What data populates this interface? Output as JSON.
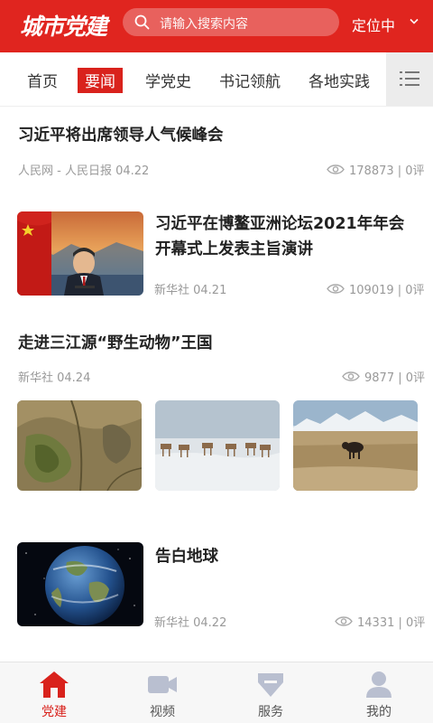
{
  "header": {
    "logo": "城市党建",
    "search_placeholder": "请输入搜索内容",
    "location": "定位中"
  },
  "tabs": [
    "首页",
    "要闻",
    "学党史",
    "书记领航",
    "各地实践"
  ],
  "active_tab": "要闻",
  "articles": [
    {
      "title": "习近平将出席领导人气候峰会",
      "source": "人民网 - 人民日报 04.22",
      "stats": "178873 | 0评"
    },
    {
      "title_line1": "习近平在博鳌亚洲论坛2021年年会",
      "title_line2": "开幕式上发表主旨演讲",
      "source": "新华社 04.21",
      "stats": "109019 | 0评"
    },
    {
      "title": "走进三江源“野生动物”王国",
      "source": "新华社 04.24",
      "stats": "9877 | 0评"
    },
    {
      "title": "告白地球",
      "source": "新华社 04.22",
      "stats": "14331 | 0评"
    }
  ],
  "bottom_nav": [
    "党建",
    "视频",
    "服务",
    "我的"
  ],
  "colors": {
    "brand": "#e0251f",
    "active_tab": "#d9221c",
    "muted": "#999999",
    "nav_icon": "#b9bfd0"
  }
}
